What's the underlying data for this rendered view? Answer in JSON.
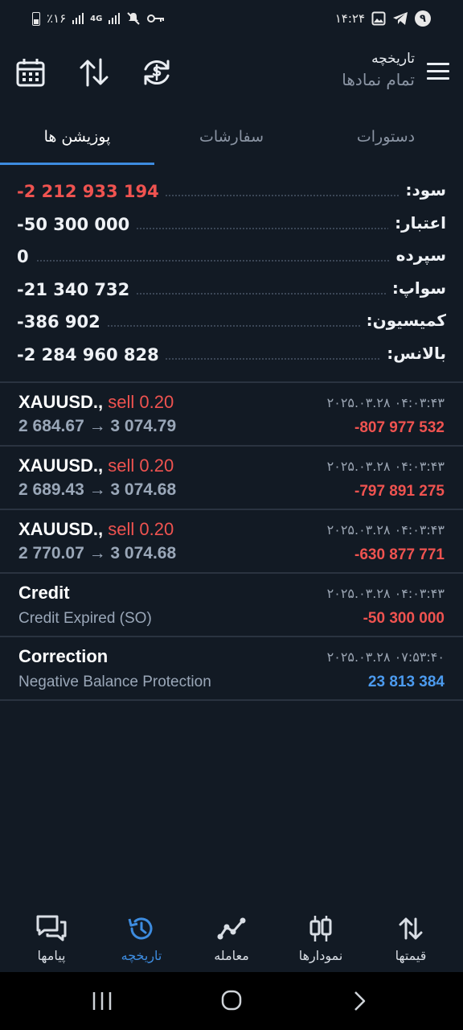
{
  "status_bar": {
    "time": "۱۴:۲۴",
    "notification_count": "۹",
    "battery_percent": "٪۱۶",
    "network": "4G"
  },
  "header": {
    "title": "تاریخچه",
    "subtitle": "تمام نمادها"
  },
  "tabs": [
    {
      "label": "دستورات",
      "active": false
    },
    {
      "label": "سفارشات",
      "active": false
    },
    {
      "label": "پوزیشن ها",
      "active": true
    }
  ],
  "summary": [
    {
      "label": "سود:",
      "value": "-2 212 933 194",
      "negative": true
    },
    {
      "label": "اعتبار:",
      "value": "-50 300 000",
      "negative": false
    },
    {
      "label": "سپرده",
      "value": "0",
      "negative": false
    },
    {
      "label": "سواپ:",
      "value": "-21 340 732",
      "negative": false
    },
    {
      "label": "کمیسیون:",
      "value": "-386 902",
      "negative": false
    },
    {
      "label": "بالانس:",
      "value": "-2 284 960 828",
      "negative": false
    }
  ],
  "deals": [
    {
      "symbol": "XAUUSD.,",
      "side": "sell 0.20",
      "detail": "2 684.67 → 3 074.79",
      "time": "۲۰۲۵.۰۳.۲۸ ۰۴:۰۳:۴۳",
      "profit": "-807 977 532",
      "positive": false
    },
    {
      "symbol": "XAUUSD.,",
      "side": "sell 0.20",
      "detail": "2 689.43 → 3 074.68",
      "time": "۲۰۲۵.۰۳.۲۸ ۰۴:۰۳:۴۳",
      "profit": "-797 891 275",
      "positive": false
    },
    {
      "symbol": "XAUUSD.,",
      "side": "sell 0.20",
      "detail": "2 770.07 → 3 074.68",
      "time": "۲۰۲۵.۰۳.۲۸ ۰۴:۰۳:۴۳",
      "profit": "-630 877 771",
      "positive": false
    },
    {
      "symbol": "Credit",
      "side": "",
      "detail": "Credit Expired (SO)",
      "time": "۲۰۲۵.۰۳.۲۸ ۰۴:۰۳:۴۳",
      "profit": "-50 300 000",
      "positive": false
    },
    {
      "symbol": "Correction",
      "side": "",
      "detail": "Negative Balance Protection",
      "time": "۲۰۲۵.۰۳.۲۸ ۰۷:۵۳:۴۰",
      "profit": "23 813 384",
      "positive": true
    }
  ],
  "bottom_nav": [
    {
      "label": "پیامها",
      "icon": "messages-icon",
      "active": false
    },
    {
      "label": "تاریخچه",
      "icon": "history-icon",
      "active": true
    },
    {
      "label": "معامله",
      "icon": "trade-icon",
      "active": false
    },
    {
      "label": "نمودارها",
      "icon": "chart-candles-icon",
      "active": false
    },
    {
      "label": "قیمتها",
      "icon": "quotes-icon",
      "active": false
    }
  ],
  "colors": {
    "background": "#121a24",
    "accent": "#3d8ce0",
    "loss": "#ef5350",
    "profit": "#4c9bef"
  }
}
